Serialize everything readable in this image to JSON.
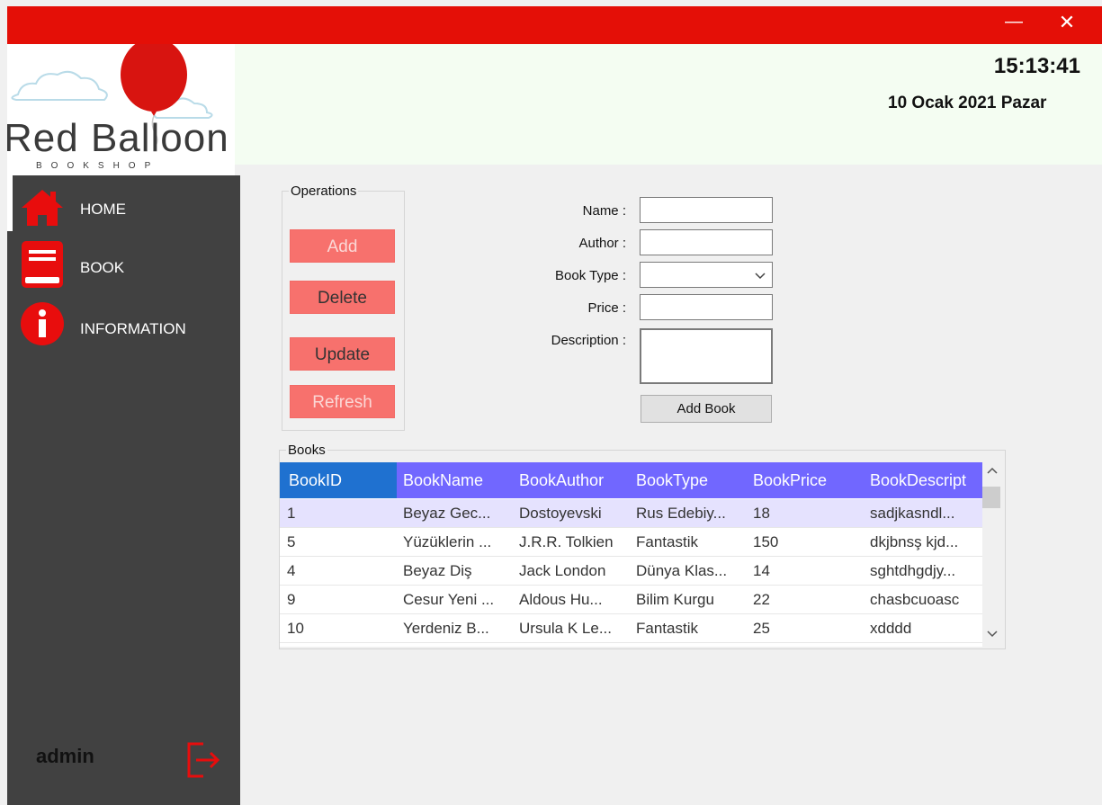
{
  "window": {
    "minimize_glyph": "—",
    "close_glyph": "✕"
  },
  "logo": {
    "title": "Red Balloon",
    "subtitle": "BOOKSHOP",
    "balloon_color": "#e40f07"
  },
  "header": {
    "time": "15:13:41",
    "date": "10 Ocak 2021 Pazar"
  },
  "sidebar": {
    "items": [
      {
        "label": "HOME",
        "icon": "home-icon"
      },
      {
        "label": "BOOK",
        "icon": "book-icon"
      },
      {
        "label": "INFORMATION",
        "icon": "info-icon"
      }
    ],
    "user": "admin",
    "logout_icon": "logout-icon"
  },
  "operations": {
    "legend": "Operations",
    "buttons": {
      "add": "Add",
      "delete": "Delete",
      "update": "Update",
      "refresh": "Refresh"
    }
  },
  "form": {
    "name_label": "Name :",
    "author_label": "Author :",
    "type_label": "Book Type :",
    "price_label": "Price :",
    "description_label": "Description :",
    "name_value": "",
    "author_value": "",
    "type_value": "",
    "price_value": "",
    "description_value": "",
    "add_book_label": "Add Book"
  },
  "books": {
    "legend": "Books",
    "columns": [
      "BookID",
      "BookName",
      "BookAuthor",
      "BookType",
      "BookPrice",
      "BookDescript"
    ],
    "rows": [
      [
        "1",
        "Beyaz Gec...",
        "Dostoyevski",
        "Rus Edebiy...",
        "18",
        "sadjkasndl..."
      ],
      [
        "5",
        "Yüzüklerin ...",
        "J.R.R. Tolkien",
        "Fantastik",
        "150",
        "dkjbnsş kjd..."
      ],
      [
        "4",
        "Beyaz Diş",
        "Jack London",
        "Dünya Klas...",
        "14",
        "sghtdhgdjy..."
      ],
      [
        "9",
        "Cesur Yeni ...",
        "Aldous Hu...",
        "Bilim Kurgu",
        "22",
        "chasbcuoasc"
      ],
      [
        "10",
        "Yerdeniz B...",
        "Ursula K Le...",
        "Fantastik",
        "25",
        "xdddd"
      ]
    ],
    "selected_row": 0,
    "header_color": "#7167ff",
    "selected_color": "#e5e2fe"
  },
  "colors": {
    "accent": "#e40f07",
    "button": "#f7716d",
    "sidebar": "#414141"
  }
}
